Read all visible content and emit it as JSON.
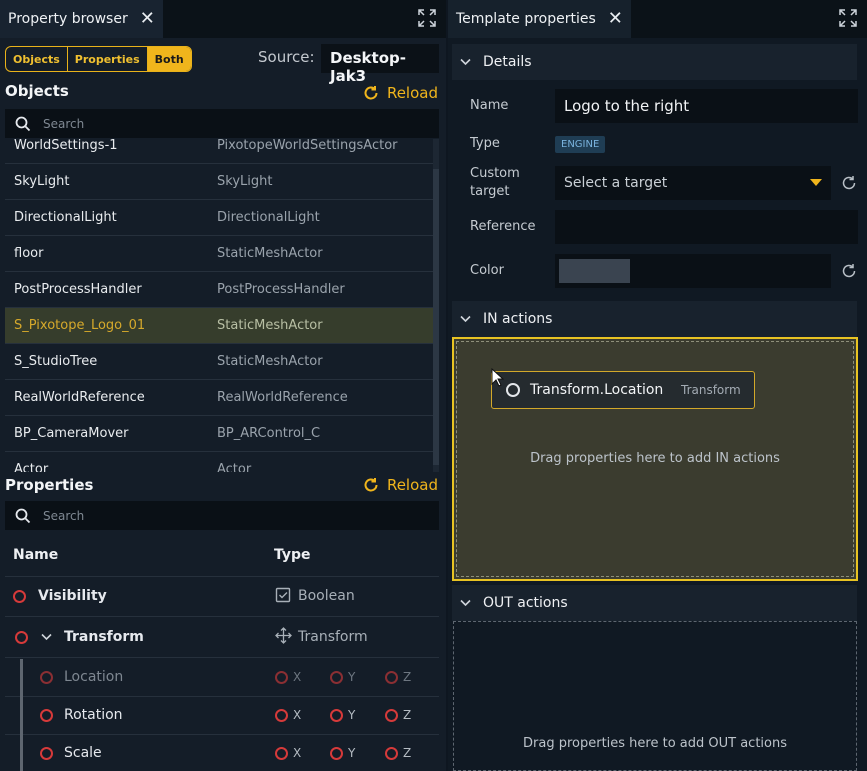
{
  "left_panel": {
    "tab_title": "Property browser",
    "toggle": [
      "Objects",
      "Properties",
      "Both"
    ],
    "source_label": "Source:",
    "source_value": "Desktop-Jak3",
    "objects_title": "Objects",
    "reload_label": "Reload",
    "search_placeholder": "Search",
    "objects": [
      {
        "name": "WorldSettings-1",
        "type": "PixotopeWorldSettingsActor"
      },
      {
        "name": "SkyLight",
        "type": "SkyLight"
      },
      {
        "name": "DirectionalLight",
        "type": "DirectionalLight"
      },
      {
        "name": "floor",
        "type": "StaticMeshActor"
      },
      {
        "name": "PostProcessHandler",
        "type": "PostProcessHandler"
      },
      {
        "name": "S_Pixotope_Logo_01",
        "type": "StaticMeshActor",
        "selected": true
      },
      {
        "name": "S_StudioTree",
        "type": "StaticMeshActor"
      },
      {
        "name": "RealWorldReference",
        "type": "RealWorldReference"
      },
      {
        "name": "BP_CameraMover",
        "type": "BP_ARControl_C"
      },
      {
        "name": "Actor",
        "type": "Actor"
      }
    ],
    "properties_title": "Properties",
    "properties_reload": "Reload",
    "properties_search_placeholder": "Search",
    "table_headers": {
      "name": "Name",
      "type": "Type"
    },
    "properties": [
      {
        "name": "Visibility",
        "type": "Boolean",
        "icon": "checkbox-icon"
      },
      {
        "name": "Transform",
        "type": "Transform",
        "icon": "move-icon"
      },
      {
        "name": "Location",
        "axes": [
          "X",
          "Y",
          "Z"
        ]
      },
      {
        "name": "Rotation",
        "axes": [
          "X",
          "Y",
          "Z"
        ]
      },
      {
        "name": "Scale",
        "axes": [
          "X",
          "Y",
          "Z"
        ]
      }
    ]
  },
  "right_panel": {
    "tab_title": "Template properties",
    "details_title": "Details",
    "fields": {
      "name_label": "Name",
      "name_value": "Logo to the right",
      "type_label": "Type",
      "type_value": "ENGINE",
      "custom_target_label": "Custom target",
      "custom_target_placeholder": "Select a target",
      "reference_label": "Reference",
      "reference_value": "",
      "color_label": "Color"
    },
    "in_actions_title": "IN actions",
    "in_drag_text": "Drag properties here to add IN actions",
    "dragged_chip": {
      "label": "Transform.Location",
      "type": "Transform"
    },
    "out_actions_title": "OUT actions",
    "out_drag_text": "Drag properties here to add OUT actions"
  },
  "colors": {
    "accent": "#f0b51c",
    "selected_row": "#363d2c",
    "remove_circle": "#d63a3a",
    "type_badge": "#1f3d54"
  }
}
